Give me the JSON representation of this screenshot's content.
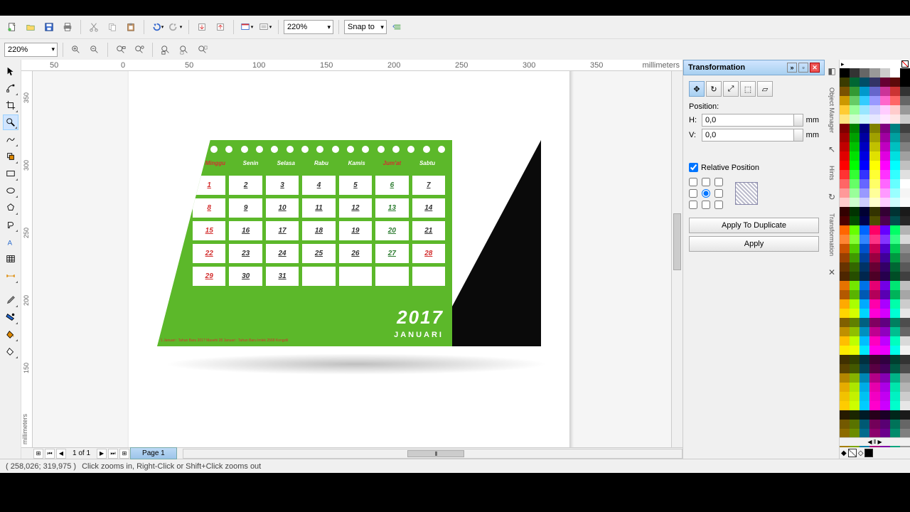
{
  "toolbar": {
    "zoom_main": "220%",
    "snap_label": "Snap to",
    "zoom_side": "220%"
  },
  "ruler": {
    "h_unit": "millimeters",
    "v_unit": "millimeters",
    "h_ticks": [
      "50",
      "0",
      "50",
      "100",
      "150",
      "200",
      "250",
      "300",
      "350"
    ],
    "v_ticks": [
      "350",
      "300",
      "250",
      "200",
      "150"
    ]
  },
  "calendar": {
    "year": "2017",
    "month": "JANUARI",
    "day_headers": [
      "Minggu",
      "Senin",
      "Selasa",
      "Rabu",
      "Kamis",
      "Jum'at",
      "Sabtu"
    ],
    "cells": [
      {
        "n": "1",
        "red": true
      },
      {
        "n": "2"
      },
      {
        "n": "3"
      },
      {
        "n": "4"
      },
      {
        "n": "5"
      },
      {
        "n": "6",
        "green": true
      },
      {
        "n": "7"
      },
      {
        "n": "8",
        "red": true
      },
      {
        "n": "9"
      },
      {
        "n": "10"
      },
      {
        "n": "11"
      },
      {
        "n": "12"
      },
      {
        "n": "13",
        "green": true
      },
      {
        "n": "14"
      },
      {
        "n": "15",
        "red": true
      },
      {
        "n": "16"
      },
      {
        "n": "17"
      },
      {
        "n": "18"
      },
      {
        "n": "19"
      },
      {
        "n": "20",
        "green": true
      },
      {
        "n": "21"
      },
      {
        "n": "22",
        "red": true
      },
      {
        "n": "23"
      },
      {
        "n": "24"
      },
      {
        "n": "25"
      },
      {
        "n": "26"
      },
      {
        "n": "27",
        "green": true
      },
      {
        "n": "28",
        "red": true
      },
      {
        "n": "29",
        "red": true
      },
      {
        "n": "30"
      },
      {
        "n": "31"
      },
      {
        "n": "",
        "empty": true
      },
      {
        "n": "",
        "empty": true
      },
      {
        "n": "",
        "empty": true
      },
      {
        "n": "",
        "empty": true
      }
    ],
    "footer": "1 Januari : Tahun Baru 2017 Masehi\n28 Januari : Tahun Baru Imlek 2568 Kongzili"
  },
  "page_nav": {
    "info": "1 of 1",
    "tab": "Page 1"
  },
  "docker": {
    "title": "Transformation",
    "position_label": "Position:",
    "h_label": "H:",
    "v_label": "V:",
    "h_val": "0,0",
    "v_val": "0,0",
    "unit": "mm",
    "relative": "Relative Position",
    "apply_dup": "Apply To Duplicate",
    "apply": "Apply"
  },
  "side_tabs": [
    "Object Manager",
    "Hints",
    "Transformation"
  ],
  "status": {
    "coords": "( 258,026; 319,975 )",
    "hint": "Click zooms in, Right-Click or Shift+Click zooms out"
  },
  "palette_colors": [
    "#000000",
    "#333333",
    "#666666",
    "#999999",
    "#cccccc",
    "#ffffff",
    "#000000",
    "#3b3b00",
    "#006633",
    "#004d66",
    "#333366",
    "#660033",
    "#5c0a0a",
    "#000000",
    "#7a5200",
    "#339933",
    "#0099cc",
    "#6666cc",
    "#cc3399",
    "#cc3333",
    "#333333",
    "#cc9900",
    "#66cc66",
    "#33ccff",
    "#9999ff",
    "#ff66cc",
    "#ff6666",
    "#666666",
    "#ffcc33",
    "#99ff99",
    "#99e6ff",
    "#ccccff",
    "#ffccff",
    "#ffcccc",
    "#999999",
    "#ffe680",
    "#ccffcc",
    "#ccf5ff",
    "#e6e6ff",
    "#ffe6ff",
    "#ffe6e6",
    "#cccccc",
    "#800000",
    "#008000",
    "#000080",
    "#808000",
    "#800080",
    "#008080",
    "#404040",
    "#a00000",
    "#00a000",
    "#0000a0",
    "#a0a000",
    "#a000a0",
    "#00a0a0",
    "#606060",
    "#c00000",
    "#00c000",
    "#0000c0",
    "#c0c000",
    "#c000c0",
    "#00c0c0",
    "#808080",
    "#e00000",
    "#00e000",
    "#0000e0",
    "#e0e000",
    "#e000e0",
    "#00e0e0",
    "#a0a0a0",
    "#ff0000",
    "#00ff00",
    "#0000ff",
    "#ffff00",
    "#ff00ff",
    "#00ffff",
    "#c0c0c0",
    "#ff3333",
    "#33ff33",
    "#3333ff",
    "#ffff33",
    "#ff33ff",
    "#33ffff",
    "#e0e0e0",
    "#ff6666",
    "#66ff66",
    "#6666ff",
    "#ffff66",
    "#ff66ff",
    "#66ffff",
    "#ffffff",
    "#ff9999",
    "#99ff99",
    "#9999ff",
    "#ffff99",
    "#ff99ff",
    "#99ffff",
    "#f5f5f5",
    "#ffcccc",
    "#ccffcc",
    "#ccccff",
    "#ffffcc",
    "#ffccff",
    "#ccffff",
    "#fafafa",
    "#330000",
    "#003300",
    "#000033",
    "#333300",
    "#330033",
    "#003333",
    "#1a1a1a",
    "#4d0000",
    "#004d00",
    "#00004d",
    "#4d4d00",
    "#4d004d",
    "#004d4d",
    "#262626",
    "#ff6600",
    "#66ff00",
    "#0066ff",
    "#ff0066",
    "#6600ff",
    "#00ff66",
    "#b3b3b3",
    "#ff8533",
    "#85ff33",
    "#3385ff",
    "#ff3385",
    "#8533ff",
    "#33ff85",
    "#d9d9d9",
    "#cc5200",
    "#52cc00",
    "#0052cc",
    "#cc0052",
    "#5200cc",
    "#00cc52",
    "#8c8c8c",
    "#994000",
    "#409900",
    "#004099",
    "#990040",
    "#400099",
    "#009940",
    "#737373",
    "#663300",
    "#336600",
    "#003366",
    "#660033",
    "#330066",
    "#006633",
    "#595959",
    "#4d2600",
    "#264d00",
    "#00264d",
    "#4d0026",
    "#26004d",
    "#004d26",
    "#404040",
    "#e67300",
    "#73e600",
    "#0073e6",
    "#e60073",
    "#7300e6",
    "#00e673",
    "#bfbfbf",
    "#b35900",
    "#59b300",
    "#0059b3",
    "#b30059",
    "#5900b3",
    "#00b359",
    "#a6a6a6",
    "#ffaa00",
    "#aaff00",
    "#00aaff",
    "#ff00aa",
    "#aa00ff",
    "#00ffaa",
    "#cccccc",
    "#ffd500",
    "#d5ff00",
    "#00d5ff",
    "#ff00d5",
    "#d500ff",
    "#00ffd5",
    "#e6e6e6",
    "#806000",
    "#608000",
    "#006080",
    "#800060",
    "#600080",
    "#008060",
    "#4d4d4d",
    "#bf9000",
    "#90bf00",
    "#0090bf",
    "#bf0090",
    "#9000bf",
    "#00bf90",
    "#666666",
    "#ffbf00",
    "#bfff00",
    "#00bfff",
    "#ff00bf",
    "#bf00ff",
    "#00ffbf",
    "#d9d9d9",
    "#ffea00",
    "#eaff00",
    "#00eaff",
    "#ff00ea",
    "#ea00ff",
    "#00ffea",
    "#f2f2f2",
    "#403000",
    "#304000",
    "#003040",
    "#400030",
    "#300040",
    "#004030",
    "#333333",
    "#594300",
    "#435900",
    "#004359",
    "#590043",
    "#430059",
    "#005943",
    "#4d4d4d",
    "#b38600",
    "#86b300",
    "#0086b3",
    "#b30086",
    "#8600b3",
    "#00b386",
    "#999999",
    "#e6ac00",
    "#ace600",
    "#00ace6",
    "#e600ac",
    "#ac00e6",
    "#00e6ac",
    "#b3b3b3",
    "#f2c200",
    "#c2f200",
    "#00c2f2",
    "#f200c2",
    "#c200f2",
    "#00f2c2",
    "#cccccc",
    "#ffcc00",
    "#ccff00",
    "#00ccff",
    "#ff00cc",
    "#cc00ff",
    "#00ffcc",
    "#e6e6e6",
    "#261a00",
    "#1a2600",
    "#001a26",
    "#26001a",
    "#1a0026",
    "#00261a",
    "#1a1a1a",
    "#735900",
    "#597300",
    "#005973",
    "#730059",
    "#590073",
    "#007359",
    "#666666",
    "#8c6b00",
    "#6b8c00",
    "#006b8c",
    "#8c006b",
    "#6b008c",
    "#008c6b",
    "#808080",
    "#a67e00",
    "#7ea600",
    "#007ea6",
    "#a6007e",
    "#7e00a6",
    "#00a67e",
    "#999999"
  ]
}
